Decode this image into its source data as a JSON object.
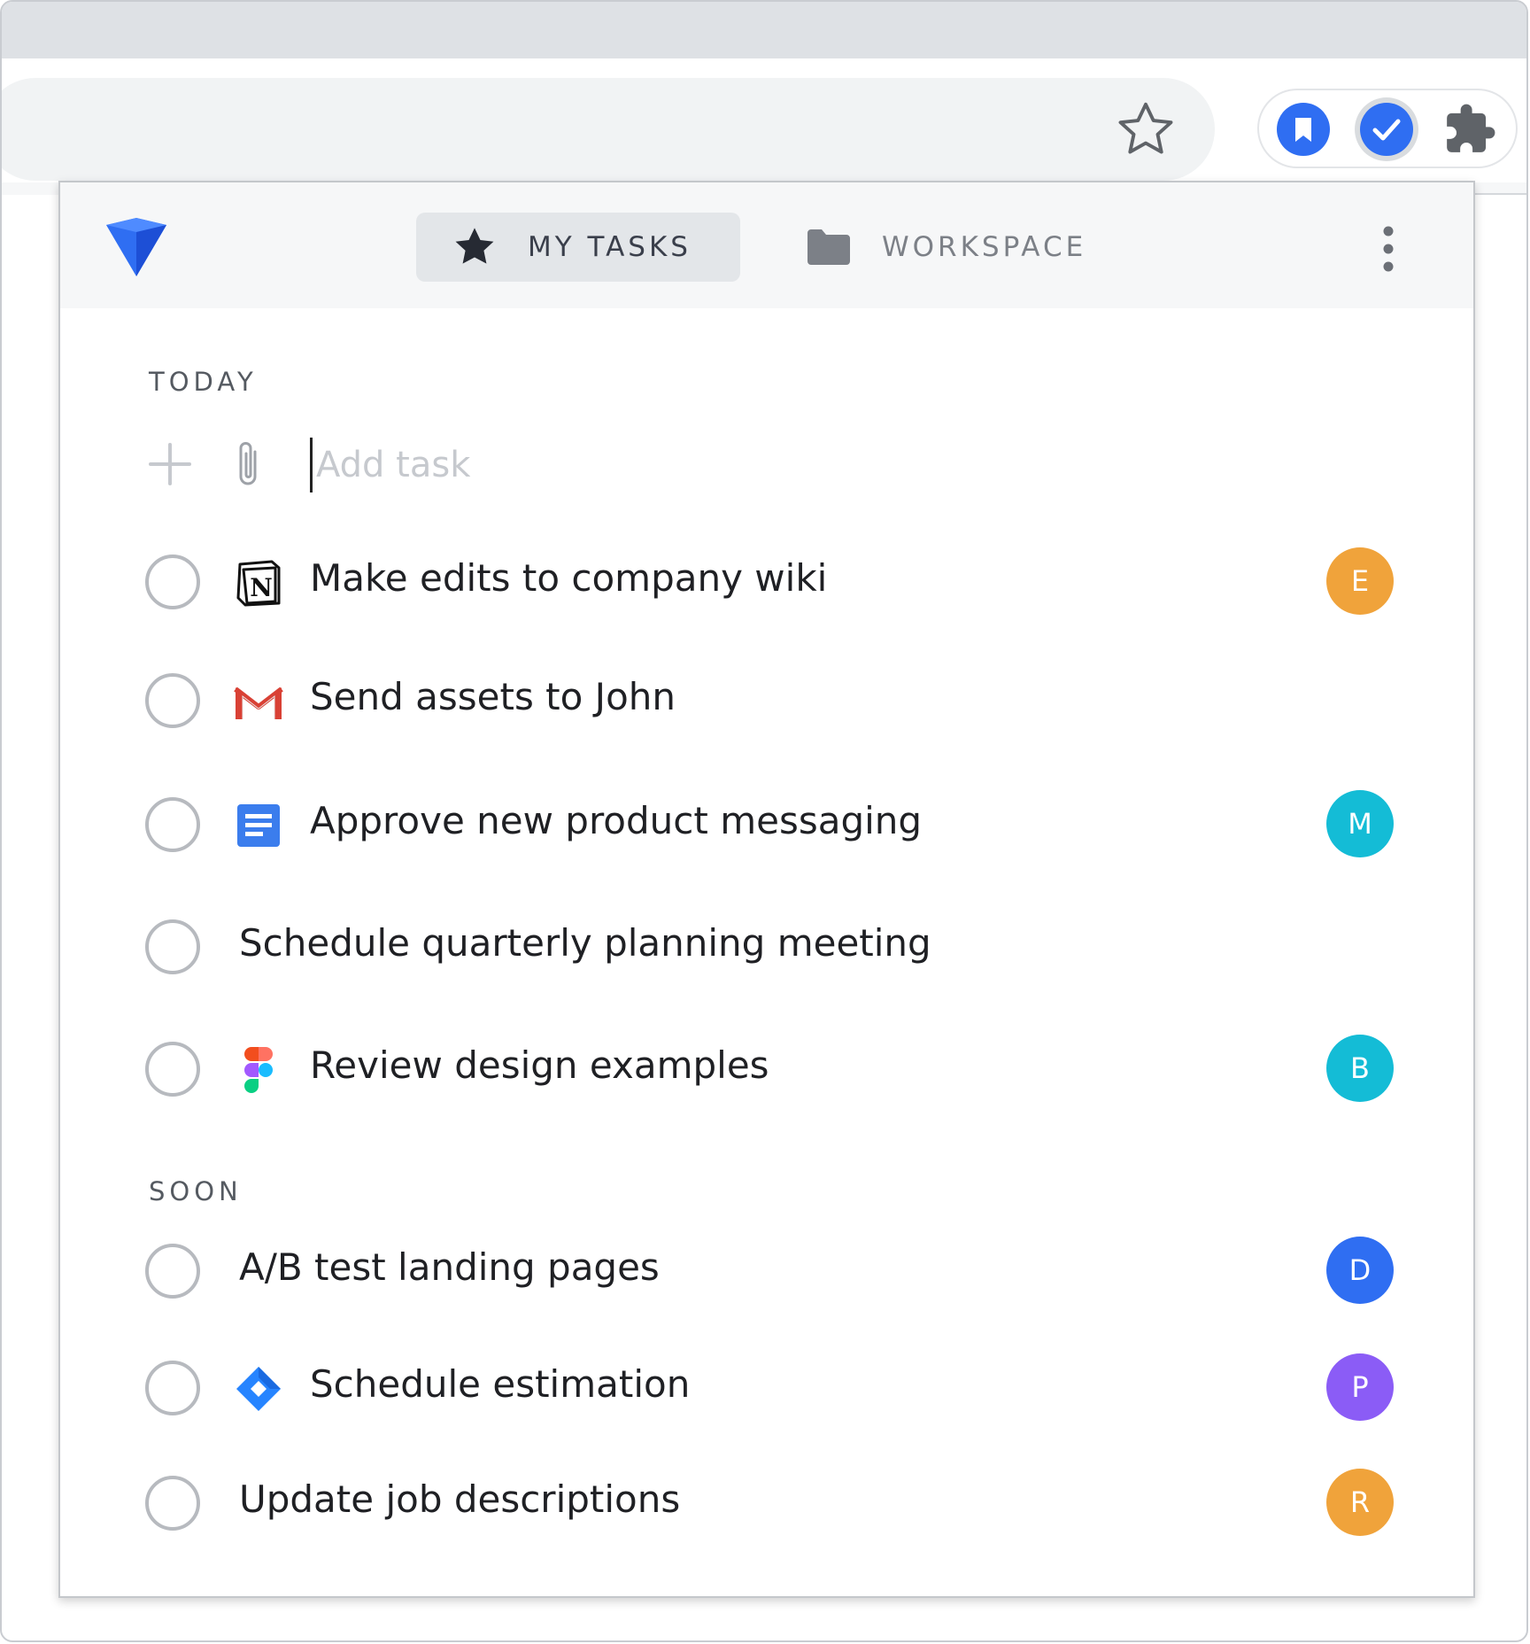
{
  "browser": {
    "extensions": [
      {
        "name": "bookmark-extension-icon",
        "color": "#2f6ef2"
      },
      {
        "name": "tasks-extension-icon",
        "color": "#2f6ef2"
      },
      {
        "name": "extensions-puzzle-icon",
        "color": "#5f6368"
      }
    ]
  },
  "popup": {
    "tabs": {
      "my_tasks": "MY TASKS",
      "workspace": "WORKSPACE"
    },
    "today": {
      "title": "TODAY",
      "add_placeholder": "Add task",
      "tasks": [
        {
          "text": "Make edits to company wiki",
          "icon": "notion-icon",
          "assignee": "E",
          "color": "#f0a33b"
        },
        {
          "text": "Send assets to John",
          "icon": "gmail-icon",
          "assignee": "",
          "color": ""
        },
        {
          "text": "Approve new product messaging",
          "icon": "google-docs-icon",
          "assignee": "M",
          "color": "#14bcd6"
        },
        {
          "text": "Schedule quarterly planning meeting",
          "icon": "",
          "assignee": "",
          "color": ""
        },
        {
          "text": "Review design examples",
          "icon": "figma-icon",
          "assignee": "B",
          "color": "#14bcd6"
        }
      ]
    },
    "soon": {
      "title": "SOON",
      "tasks": [
        {
          "text": "A/B test landing pages",
          "icon": "",
          "assignee": "D",
          "color": "#2f6ef2"
        },
        {
          "text": "Schedule estimation",
          "icon": "jira-icon",
          "assignee": "P",
          "color": "#8b5cf6"
        },
        {
          "text": "Update job descriptions",
          "icon": "",
          "assignee": "R",
          "color": "#f0a33b"
        }
      ]
    }
  }
}
